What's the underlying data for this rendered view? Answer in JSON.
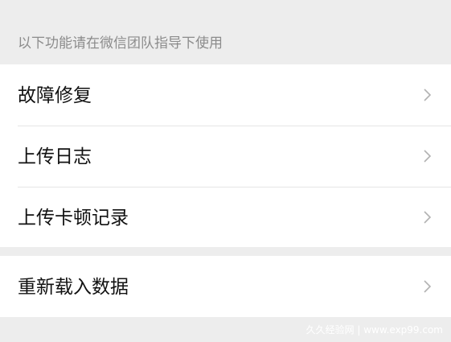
{
  "section": {
    "hint": "以下功能请在微信团队指导下使用"
  },
  "items": [
    {
      "label": "故障修复",
      "icon": "chevron-right-icon"
    },
    {
      "label": "上传日志",
      "icon": "chevron-right-icon"
    },
    {
      "label": "上传卡顿记录",
      "icon": "chevron-right-icon"
    },
    {
      "label": "重新载入数据",
      "icon": "chevron-right-icon"
    }
  ],
  "watermark": "久久经验网 | www.exp99.com",
  "colors": {
    "background": "#ededed",
    "card": "#ffffff",
    "text": "#111111",
    "hint_text": "#8c8c8c",
    "chevron": "#b2b2b2"
  }
}
